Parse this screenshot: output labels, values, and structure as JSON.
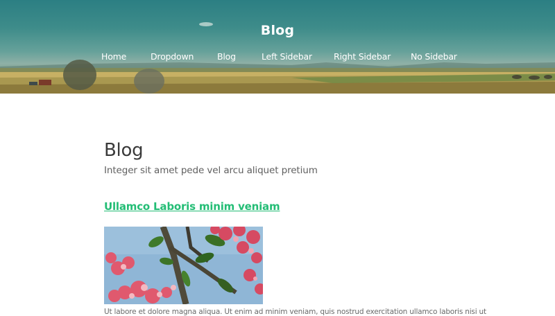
{
  "header": {
    "site_title": "Blog",
    "nav": [
      "Home",
      "Dropdown",
      "Blog",
      "Left Sidebar",
      "Right Sidebar",
      "No Sidebar"
    ]
  },
  "main": {
    "page_title": "Blog",
    "page_subtitle": "Integer sit amet pede vel arcu aliquet pretium",
    "post": {
      "title": "Ullamco Laboris minim veniam",
      "excerpt": "Ut labore et dolore magna aliqua. Ut enim ad minim veniam, quis nostrud exercitation ullamco laboris nisi ut"
    }
  },
  "colors": {
    "link_accent": "#23bd75",
    "heading_text": "#3a3a3a",
    "body_text": "#606060"
  }
}
